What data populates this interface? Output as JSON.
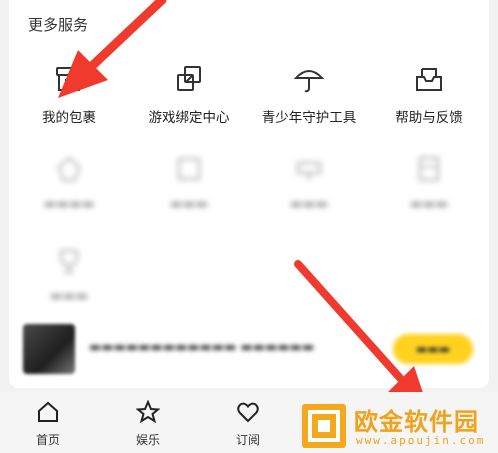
{
  "section": {
    "title": "更多服务"
  },
  "services": [
    {
      "label": "我的包裹",
      "icon": "package-box-icon"
    },
    {
      "label": "游戏绑定中心",
      "icon": "link-copy-icon"
    },
    {
      "label": "青少年守护工具",
      "icon": "umbrella-icon"
    },
    {
      "label": "帮助与反馈",
      "icon": "help-inbox-icon"
    }
  ],
  "blurred_services": [
    {
      "label": "",
      "icon": "blurred-icon"
    },
    {
      "label": "",
      "icon": "blurred-icon"
    },
    {
      "label": "",
      "icon": "blurred-icon"
    },
    {
      "label": "",
      "icon": "blurred-icon"
    },
    {
      "label": "",
      "icon": "trophy-icon"
    }
  ],
  "banner": {
    "text": "",
    "button": ""
  },
  "tabbar": [
    {
      "label": "首页",
      "icon": "home-icon"
    },
    {
      "label": "娱乐",
      "icon": "star-icon"
    },
    {
      "label": "订阅",
      "icon": "heart-icon"
    }
  ],
  "watermark": {
    "title": "欧金软件园",
    "url": "www.apoujin.com"
  },
  "colors": {
    "arrow": "#f03a2e",
    "accent": "#ffd21f",
    "watermark": "#f0a21a"
  }
}
